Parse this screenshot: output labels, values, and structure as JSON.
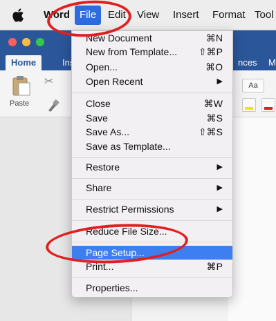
{
  "menubar": {
    "app_name": "Word",
    "items": [
      "File",
      "Edit",
      "View",
      "Insert",
      "Format",
      "Tool"
    ]
  },
  "word_window": {
    "tabs": [
      "Home",
      "Ins",
      "nces",
      "M"
    ],
    "paste_label": "Paste",
    "font_size_button": "Aa"
  },
  "file_menu": {
    "items": [
      {
        "label": "New Document",
        "shortcut": "⌘N"
      },
      {
        "label": "New from Template...",
        "shortcut": "⇧⌘P"
      },
      {
        "label": "Open...",
        "shortcut": "⌘O"
      },
      {
        "label": "Open Recent",
        "submenu": "▶"
      },
      {
        "label": "Close",
        "shortcut": "⌘W"
      },
      {
        "label": "Save",
        "shortcut": "⌘S"
      },
      {
        "label": "Save As...",
        "shortcut": "⇧⌘S"
      },
      {
        "label": "Save as Template..."
      },
      {
        "label": "Restore",
        "submenu": "▶"
      },
      {
        "label": "Share",
        "submenu": "▶"
      },
      {
        "label": "Restrict Permissions",
        "submenu": "▶"
      },
      {
        "label": "Reduce File Size..."
      },
      {
        "label": "Page Setup...",
        "highlighted": true
      },
      {
        "label": "Print...",
        "shortcut": "⌘P"
      },
      {
        "label": "Properties..."
      }
    ]
  },
  "colors": {
    "menu_highlight": "#3d7ff0",
    "annotation_ring": "#e02020",
    "word_blue": "#2b579a"
  }
}
